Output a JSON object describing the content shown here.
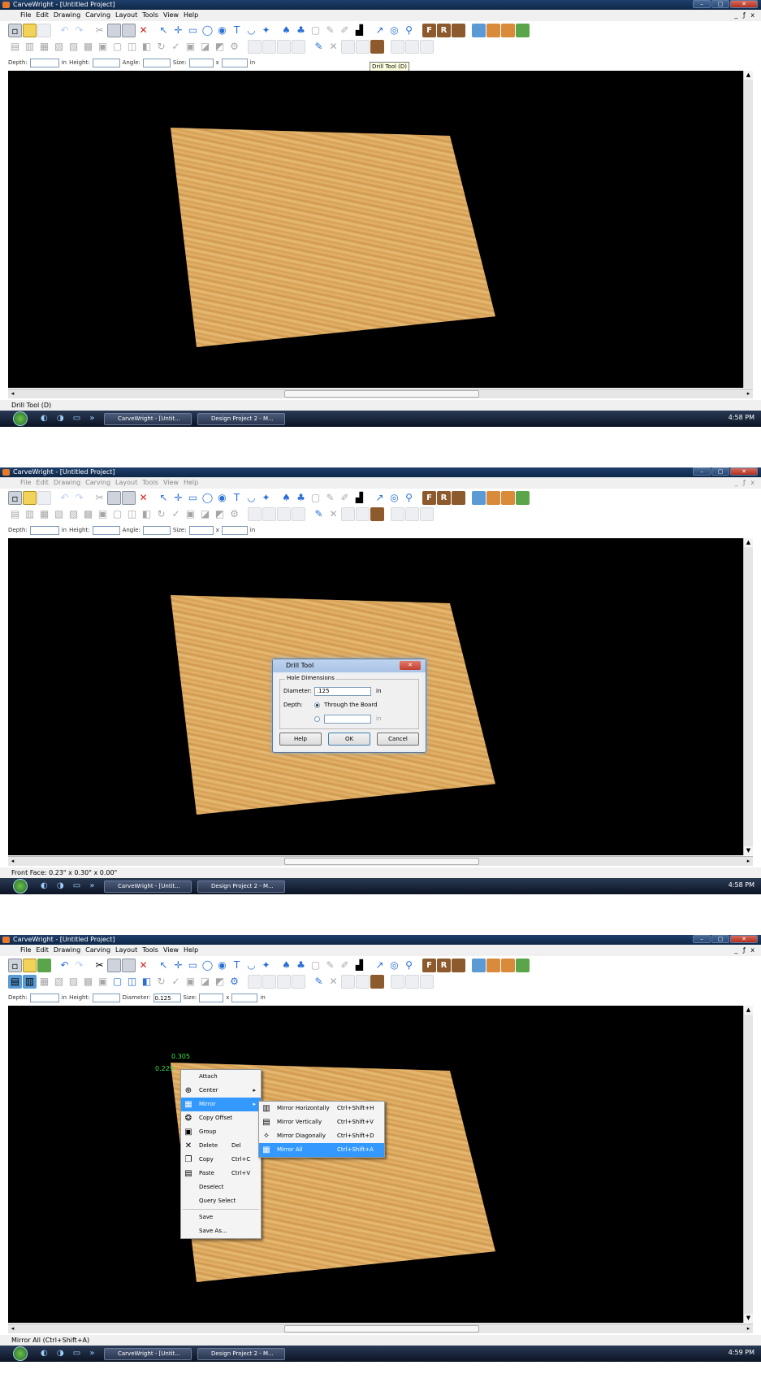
{
  "app": {
    "title": "CarveWright - [Untitled Project]"
  },
  "menu": [
    "File",
    "Edit",
    "Drawing",
    "Carving",
    "Layout",
    "Tools",
    "View",
    "Help"
  ],
  "mdi_controls": "_ ƒ x",
  "propbar": {
    "depth": "Depth:",
    "in": "in",
    "height": "Height:",
    "angle": "Angle:",
    "size": "Size:",
    "x": "x",
    "diameter": "Diameter:",
    "diameter_value": "0.125"
  },
  "tooltip": "Drill Tool (D)",
  "statuses": [
    "Drill Tool (D)",
    "Front Face: 0.23\" x 0.30\" x 0.00\"",
    "Mirror All (Ctrl+Shift+A)"
  ],
  "taskbar": {
    "task1": "CarveWright - [Untit...",
    "task2": "Design Project 2 - M...",
    "times": [
      "4:58 PM",
      "4:58 PM",
      "4:59 PM"
    ]
  },
  "dialog": {
    "title": "Drill Tool",
    "group": "Hole Dimensions",
    "diameter_label": "Diameter:",
    "diameter_value": ".125",
    "unit": "in",
    "depth_label": "Depth:",
    "option1": "Through the Board",
    "option2_unit": "in",
    "help": "Help",
    "ok": "OK",
    "cancel": "Cancel"
  },
  "measure": {
    "a": "0.305",
    "b": "0.229"
  },
  "context_menu": {
    "items": [
      {
        "label": "Attach",
        "sc": "",
        "icon": ""
      },
      {
        "label": "Center",
        "sc": "",
        "icon": "⊕",
        "arrow": "▸"
      },
      {
        "label": "Mirror",
        "sc": "",
        "icon": "▦",
        "arrow": "▸",
        "hl": true
      },
      {
        "label": "Copy Offset",
        "sc": "",
        "icon": "❂"
      },
      {
        "label": "Group",
        "sc": "",
        "icon": "▣"
      },
      {
        "label": "Delete",
        "sc": "Del",
        "icon": "✕"
      },
      {
        "label": "Copy",
        "sc": "Ctrl+C",
        "icon": "❐"
      },
      {
        "label": "Paste",
        "sc": "Ctrl+V",
        "icon": "▤"
      },
      {
        "label": "Deselect",
        "sc": "",
        "icon": ""
      },
      {
        "label": "Query Select",
        "sc": "",
        "icon": ""
      },
      {
        "label": "Save",
        "sc": "",
        "icon": ""
      },
      {
        "label": "Save As...",
        "sc": "",
        "icon": ""
      }
    ],
    "submenu": [
      {
        "label": "Mirror Horizontally",
        "sc": "Ctrl+Shift+H",
        "icon": "▥"
      },
      {
        "label": "Mirror Vertically",
        "sc": "Ctrl+Shift+V",
        "icon": "▤"
      },
      {
        "label": "Mirror Diagonally",
        "sc": "Ctrl+Shift+D",
        "icon": "✧"
      },
      {
        "label": "Mirror All",
        "sc": "Ctrl+Shift+A",
        "icon": "▦",
        "hl": true
      }
    ]
  },
  "icons": [
    "new",
    "open",
    "save",
    "undo",
    "redo",
    "cut",
    "copy",
    "paste",
    "delete",
    "select",
    "crosshair",
    "rectangle",
    "circle",
    "curve",
    "text",
    "merge",
    "pick",
    "patterns",
    "layers",
    "line",
    "pen",
    "level",
    "arrow",
    "search",
    "front",
    "rear",
    "board",
    "texture",
    "grid",
    "tiles",
    "photo"
  ]
}
